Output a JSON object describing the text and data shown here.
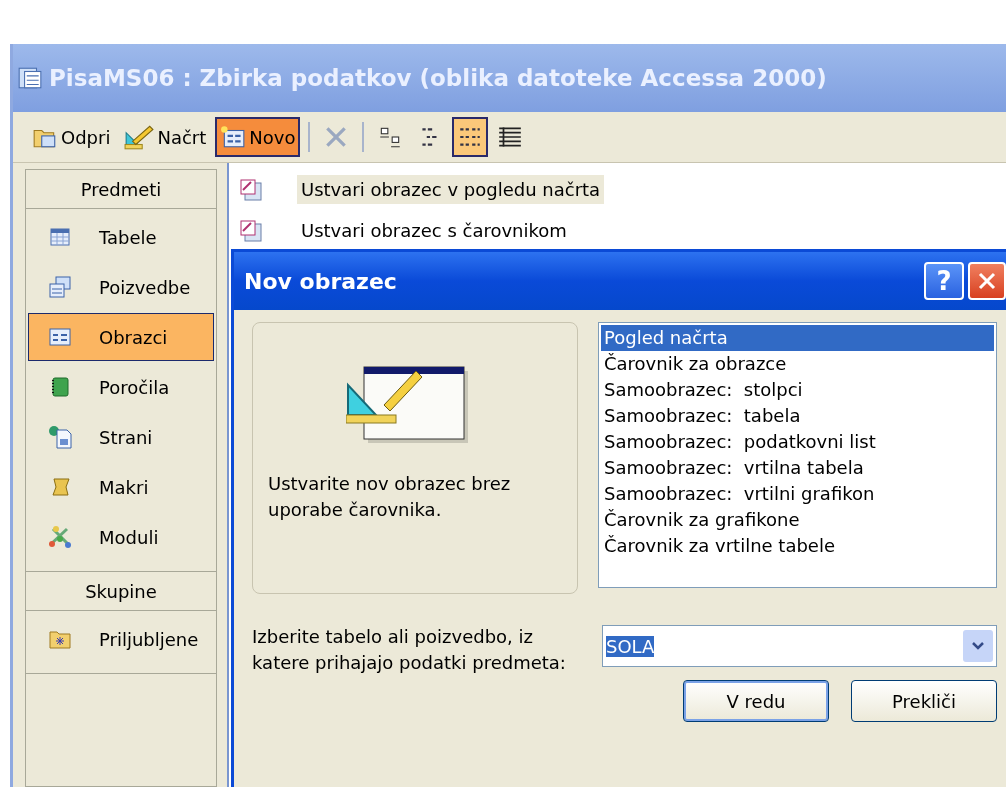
{
  "window": {
    "title": "PisaMS06 : Zbirka podatkov (oblika datoteke Accessa 2000)"
  },
  "toolbar": {
    "buttons": [
      {
        "kind": "open",
        "label": "Odpri",
        "selected": false
      },
      {
        "kind": "design",
        "label": "Načrt",
        "selected": false
      },
      {
        "kind": "new",
        "label": "Novo",
        "selected": true
      }
    ],
    "view_buttons": [
      {
        "kind": "delete",
        "selected": false
      },
      {
        "kind": "large",
        "selected": false
      },
      {
        "kind": "small",
        "selected": false
      },
      {
        "kind": "list",
        "selected": true
      },
      {
        "kind": "details",
        "selected": false
      }
    ]
  },
  "sidebar": {
    "sections": [
      {
        "header": "Predmeti",
        "items": [
          {
            "kind": "table",
            "label": "Tabele",
            "selected": false
          },
          {
            "kind": "query",
            "label": "Poizvedbe",
            "selected": false
          },
          {
            "kind": "form",
            "label": "Obrazci",
            "selected": true
          },
          {
            "kind": "report",
            "label": "Poročila",
            "selected": false
          },
          {
            "kind": "page",
            "label": "Strani",
            "selected": false
          },
          {
            "kind": "macro",
            "label": "Makri",
            "selected": false
          },
          {
            "kind": "module",
            "label": "Moduli",
            "selected": false
          }
        ]
      },
      {
        "header": "Skupine",
        "items": [
          {
            "kind": "favorites",
            "label": "Priljubljene",
            "selected": false
          }
        ]
      }
    ]
  },
  "objects": [
    {
      "label": "Ustvari obrazec v pogledu načrta",
      "selected": true
    },
    {
      "label": "Ustvari obrazec s čarovnikom",
      "selected": false
    }
  ],
  "dialog": {
    "title": "Nov obrazec",
    "help": "?",
    "description": "Ustvarite nov obrazec brez uporabe čarovnika.",
    "options": [
      {
        "label": "Pogled načrta",
        "selected": true
      },
      {
        "label": "Čarovnik za obrazce",
        "selected": false
      },
      {
        "label": "Samoobrazec:  stolpci",
        "selected": false
      },
      {
        "label": "Samoobrazec:  tabela",
        "selected": false
      },
      {
        "label": "Samoobrazec:  podatkovni list",
        "selected": false
      },
      {
        "label": "Samoobrazec:  vrtilna tabela",
        "selected": false
      },
      {
        "label": "Samoobrazec:  vrtilni grafikon",
        "selected": false
      },
      {
        "label": "Čarovnik za grafikone",
        "selected": false
      },
      {
        "label": "Čarovnik za vrtilne tabele",
        "selected": false
      }
    ],
    "source_label": "Izberite tabelo ali poizvedbo, iz katere prihajajo podatki predmeta:",
    "source_value": "SOLA",
    "buttons": [
      {
        "label": "V redu",
        "default": true
      },
      {
        "label": "Prekliči",
        "default": false
      }
    ]
  }
}
